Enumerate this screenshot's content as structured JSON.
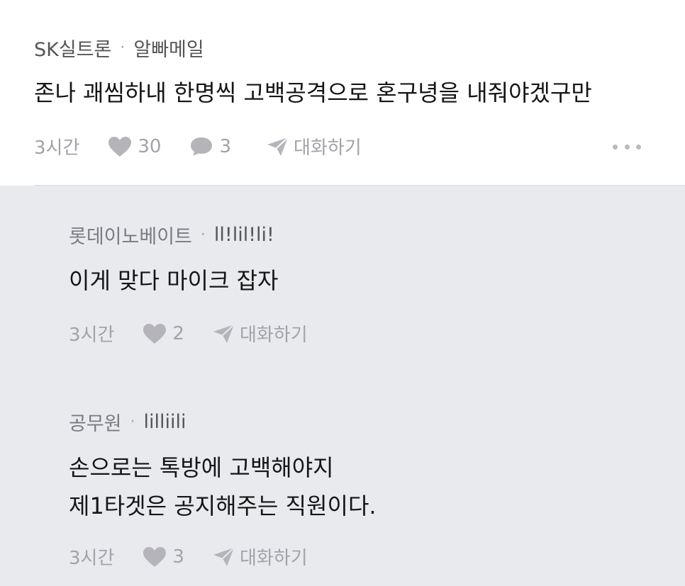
{
  "main_comment": {
    "company": "SK실트론",
    "separator": "·",
    "author": "알빠메일",
    "text": "존나 괘씸하내 한명씩 고백공격으로 혼구녕을 내줘야겠구만",
    "time": "3시간",
    "likes": "30",
    "comments": "3",
    "chat_label": "대화하기",
    "more_icon": "more-dots-icon"
  },
  "replies": [
    {
      "company": "롯데이노베이트",
      "separator": "·",
      "author": "ll!lil!li!",
      "text": "이게 맞다 마이크 잡자",
      "time": "3시간",
      "likes": "2",
      "chat_label": "대화하기"
    },
    {
      "company": "공무원",
      "separator": "·",
      "author": "lilliili",
      "text": "손으로는 톡방에 고백해야지\n제1타겟은 공지해주는 직원이다.",
      "time": "3시간",
      "likes": "3",
      "chat_label": "대화하기"
    }
  ],
  "colors": {
    "reply_background": "#e9eaee",
    "muted_text": "#8c8c92",
    "icon_gray": "#b4b4ba"
  }
}
